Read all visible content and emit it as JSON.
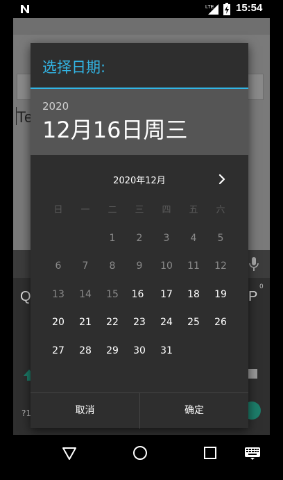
{
  "status_bar": {
    "notification_icon": "n-icon",
    "network": "LTE",
    "battery_icon": "battery-charging-icon",
    "time": "15:54"
  },
  "background": {
    "text": "Te",
    "keyboard": {
      "q": "Q",
      "p": "P",
      "p_hint": "0",
      "sym": "?1"
    }
  },
  "dialog": {
    "title": "选择日期:",
    "header": {
      "year": "2020",
      "date": "12月16日周三"
    },
    "calendar": {
      "month_label": "2020年12月",
      "next_icon": "chevron-right-icon",
      "weekdays": [
        "日",
        "一",
        "二",
        "三",
        "四",
        "五",
        "六"
      ],
      "weeks": [
        [
          "",
          "",
          "1",
          "2",
          "3",
          "4",
          "5"
        ],
        [
          "6",
          "7",
          "8",
          "9",
          "10",
          "11",
          "12"
        ],
        [
          "13",
          "14",
          "15",
          "16",
          "17",
          "18",
          "19"
        ],
        [
          "20",
          "21",
          "22",
          "23",
          "24",
          "25",
          "26"
        ],
        [
          "27",
          "28",
          "29",
          "30",
          "31",
          "",
          ""
        ]
      ],
      "selected_day": "16"
    },
    "buttons": {
      "cancel": "取消",
      "ok": "确定"
    }
  },
  "colors": {
    "accent": "#32b5e5",
    "dialog_bg": "#2e2e2e",
    "header_bg": "#555555",
    "selected_circle": "#000000"
  },
  "nav_bar": {
    "back_icon": "back-triangle-icon",
    "home_icon": "home-circle-icon",
    "recents_icon": "recents-square-icon",
    "keyboard_icon": "keyboard-icon"
  }
}
